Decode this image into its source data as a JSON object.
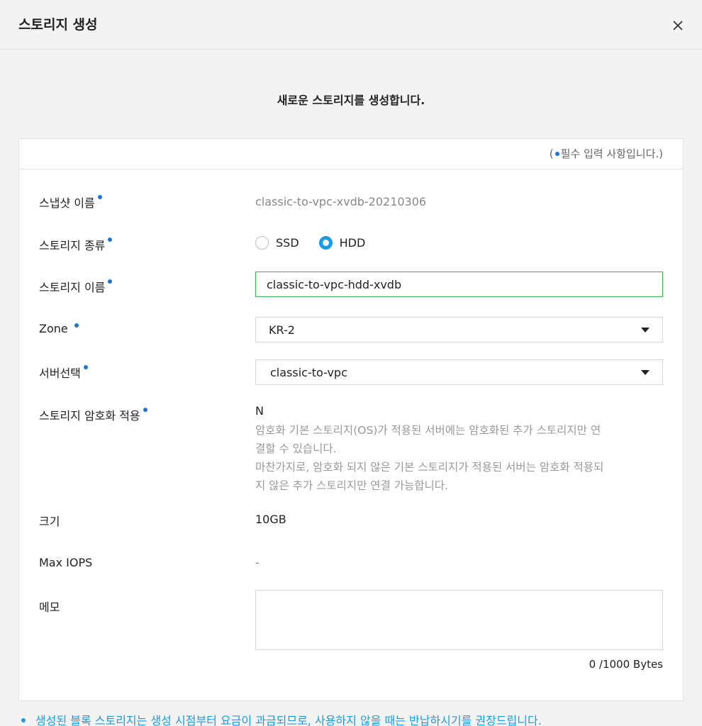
{
  "header": {
    "title": "스토리지 생성"
  },
  "subtitle": "새로운 스토리지를 생성합니다.",
  "required_note": {
    "open": "(",
    "text": "필수 입력 사항입니다.)"
  },
  "fields": {
    "snapshot_name": {
      "label": "스냅샷 이름",
      "value": "classic-to-vpc-xvdb-20210306"
    },
    "storage_type": {
      "label": "스토리지 종류",
      "options": [
        "SSD",
        "HDD"
      ],
      "selected": "HDD"
    },
    "storage_name": {
      "label": "스토리지 이름",
      "value": "classic-to-vpc-hdd-xvdb"
    },
    "zone": {
      "label": "Zone",
      "value": "KR-2"
    },
    "server": {
      "label": "서버선택",
      "value": "classic-to-vpc"
    },
    "encryption": {
      "label": "스토리지 암호화 적용",
      "value": "N",
      "desc_lines": [
        "암호화 기본 스토리지(OS)가 적용된 서버에는 암호화된 추가 스토리지만 연",
        "결할 수 있습니다.",
        "마찬가지로, 암호화 되지 않은 기본 스토리지가 적용된 서버는 암호화 적용되",
        "지 않은 추가 스토리지만 연결 가능합니다."
      ]
    },
    "size": {
      "label": "크기",
      "value": "10GB"
    },
    "max_iops": {
      "label": "Max IOPS",
      "value": "-"
    },
    "memo": {
      "label": "메모",
      "value": "",
      "byte_count": "0 /1000 Bytes"
    }
  },
  "bottom_note": "생성된 블록 스토리지는 생성 시점부터 요금이 과금되므로, 사용하지 않을 때는 반납하시기를 권장드립니다.",
  "colors": {
    "accent": "#1a73d9",
    "radio": "#1a9be6",
    "input_focus": "#36b34a",
    "note": "#1a9be6"
  }
}
